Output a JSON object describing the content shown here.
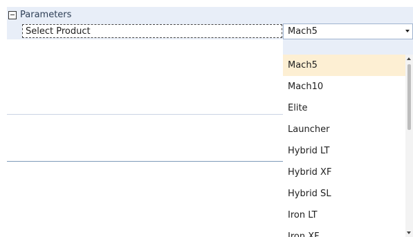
{
  "category": {
    "label": "Parameters"
  },
  "property": {
    "name": "Select Product",
    "value": "Mach5"
  },
  "dropdown": {
    "items": [
      "Mach5",
      "Mach10",
      "Elite",
      "Launcher",
      "Hybrid LT",
      "Hybrid XF",
      "Hybrid SL",
      "Iron LT",
      "Iron XF"
    ],
    "selected": "Mach5"
  },
  "colors": {
    "panel_bg": "#e8eef8",
    "selection_bg": "#fdefd3",
    "border": "#9fb3cf"
  }
}
